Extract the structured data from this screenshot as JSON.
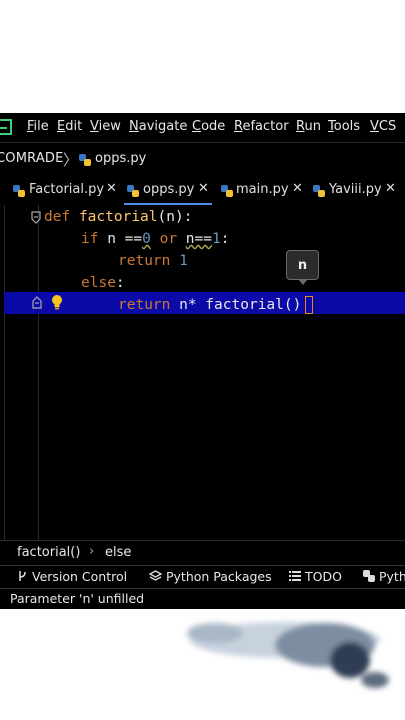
{
  "menu": [
    "File",
    "Edit",
    "View",
    "Navigate",
    "Code",
    "Refactor",
    "Run",
    "Tools",
    "VCS"
  ],
  "nav": {
    "project": "COMRADE",
    "separator": "〉",
    "file": "opps.py"
  },
  "tabs": [
    {
      "label": "Factorial.py",
      "active": false
    },
    {
      "label": "opps.py",
      "active": true
    },
    {
      "label": "main.py",
      "active": false
    },
    {
      "label": "Yaviii.py",
      "active": false
    }
  ],
  "code": {
    "line1": {
      "kw": "def",
      "name": "factorial",
      "rest": "(n):"
    },
    "line2": {
      "kw1": "if",
      "a": " n ==",
      "zero": "0",
      "or": " or ",
      "b": "n==",
      "one": "1",
      "colon": ":"
    },
    "line3": {
      "kw": "return",
      "num": "1"
    },
    "line4": {
      "kw": "else",
      "colon": ":"
    },
    "line5": {
      "kw": "return",
      "expr": " n* factorial(",
      "close": ")"
    }
  },
  "tooltip": "n",
  "breadcrumb": {
    "fn": "factorial()",
    "sep": "›",
    "block": "else"
  },
  "toolwindows": [
    "Version Control",
    "Python Packages",
    "TODO",
    "Pyth"
  ],
  "status": "Parameter 'n' unfilled",
  "colors": {
    "keyword": "#cc7832",
    "function": "#ffc66d",
    "number": "#6897bb",
    "highlight": "#0b0aa8"
  }
}
